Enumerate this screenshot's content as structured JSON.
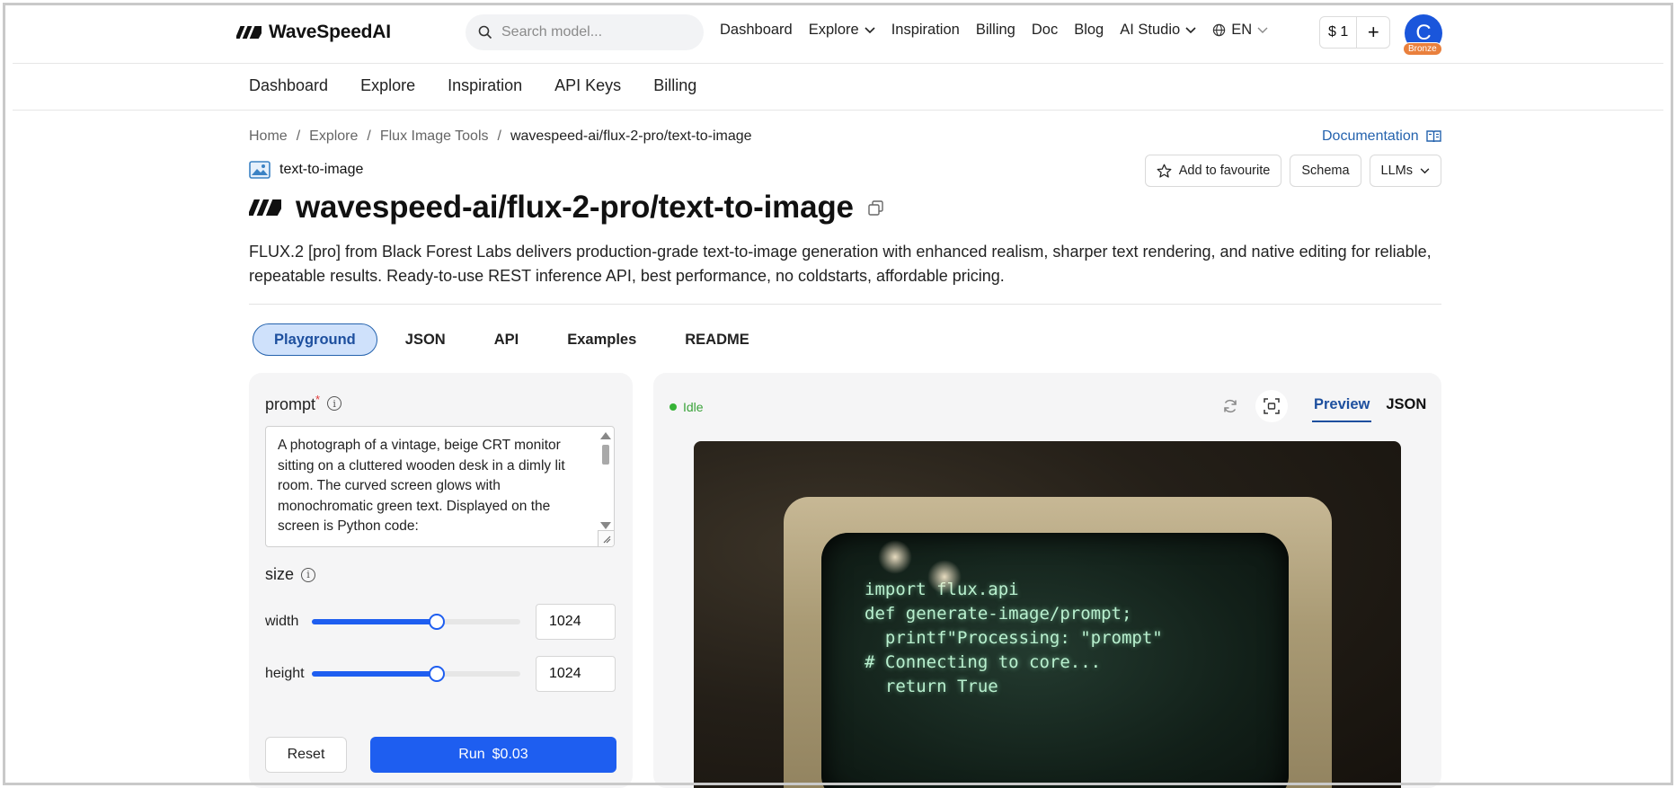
{
  "brand": {
    "name": "WaveSpeedAI"
  },
  "search": {
    "placeholder": "Search model..."
  },
  "topnav": {
    "items": [
      "Dashboard",
      "Explore",
      "Inspiration",
      "Billing",
      "Doc",
      "Blog",
      "AI Studio"
    ],
    "lang": "EN",
    "balance": "$ 1",
    "avatar_letter": "C",
    "tier": "Bronze"
  },
  "subnav": {
    "items": [
      "Dashboard",
      "Explore",
      "Inspiration",
      "API Keys",
      "Billing"
    ]
  },
  "breadcrumb": [
    "Home",
    "Explore",
    "Flux Image Tools",
    "wavespeed-ai/flux-2-pro/text-to-image"
  ],
  "documentation_link": "Documentation",
  "model": {
    "tag": "text-to-image",
    "title": "wavespeed-ai/flux-2-pro/text-to-image",
    "description": "FLUX.2 [pro] from Black Forest Labs delivers production-grade text-to-image generation with enhanced realism, sharper text rendering, and native editing for reliable, repeatable results. Ready-to-use REST inference API, best performance, no coldstarts, affordable pricing."
  },
  "actions": {
    "favourite": "Add to favourite",
    "schema": "Schema",
    "llms": "LLMs"
  },
  "tabs": [
    "Playground",
    "JSON",
    "API",
    "Examples",
    "README"
  ],
  "form": {
    "prompt_label": "prompt",
    "prompt_value": "A photograph of a vintage, beige CRT monitor sitting on a cluttered wooden desk in a dimly lit room. The curved screen glows with monochromatic green text. Displayed on the screen is Python code:",
    "size_label": "size",
    "width_label": "width",
    "width_value": "1024",
    "width_fraction": 0.6,
    "height_label": "height",
    "height_value": "1024",
    "height_fraction": 0.6,
    "reset": "Reset",
    "run": "Run",
    "price": "$0.03"
  },
  "output": {
    "status": "Idle",
    "view_tabs": [
      "Preview",
      "JSON"
    ],
    "code_on_screen": "import flux.api\ndef generate-image/prompt;\n  printf\"Processing: \"prompt\"\n# Connecting to core...\n  return True"
  },
  "colors": {
    "accent": "#1e5ef0",
    "link": "#2563ae",
    "status_ok": "#36b336",
    "bronze": "#e9803d"
  }
}
